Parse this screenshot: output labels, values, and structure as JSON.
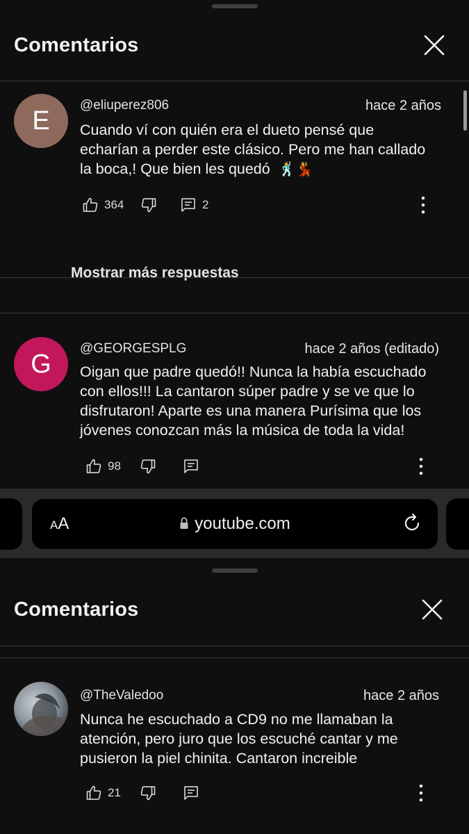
{
  "top_panel": {
    "title": "Comentarios",
    "show_more_label": "Mostrar más respuestas",
    "comments": [
      {
        "author": "@eliuperez806",
        "time": "hace 2 años",
        "avatar_letter": "E",
        "avatar_color": "#8e6a5d",
        "lines": [
          "Cuando ví con quién era el dueto pensé que",
          "echarían a perder este clásico. Pero me han callado",
          "la boca,! Que bien les quedó"
        ],
        "emoji": "🕺💃",
        "likes": "364",
        "replies": "2"
      },
      {
        "author": "@GEORGESPLG",
        "time": "hace 2 años (editado)",
        "avatar_letter": "G",
        "avatar_color": "#c2185b",
        "lines": [
          "Oigan que padre quedó!! Nunca la había escuchado",
          "con ellos!!! La cantaron súper padre y se ve que lo",
          "disfrutaron! Aparte es una manera Purísima que los",
          "jóvenes conozcan más la música de toda la vida!"
        ],
        "likes": "98"
      }
    ]
  },
  "browser": {
    "text_size_small": "A",
    "text_size_big": "A",
    "url": "youtube.com"
  },
  "bottom_panel": {
    "title": "Comentarios",
    "comments": [
      {
        "author": "@TheValedoo",
        "time": "hace 2 años",
        "lines": [
          "Nunca he escuchado a CD9 no me llamaban la",
          "atención, pero juro que los escuché cantar y me",
          "pusieron la piel chinita.  Cantaron increible"
        ],
        "likes": "21"
      }
    ]
  },
  "icons": {
    "close": "close-icon",
    "like": "thumbs-up-icon",
    "dislike": "thumbs-down-icon",
    "reply": "comment-reply-icon",
    "more": "more-vertical-icon",
    "lock": "lock-icon",
    "reload": "reload-icon"
  }
}
